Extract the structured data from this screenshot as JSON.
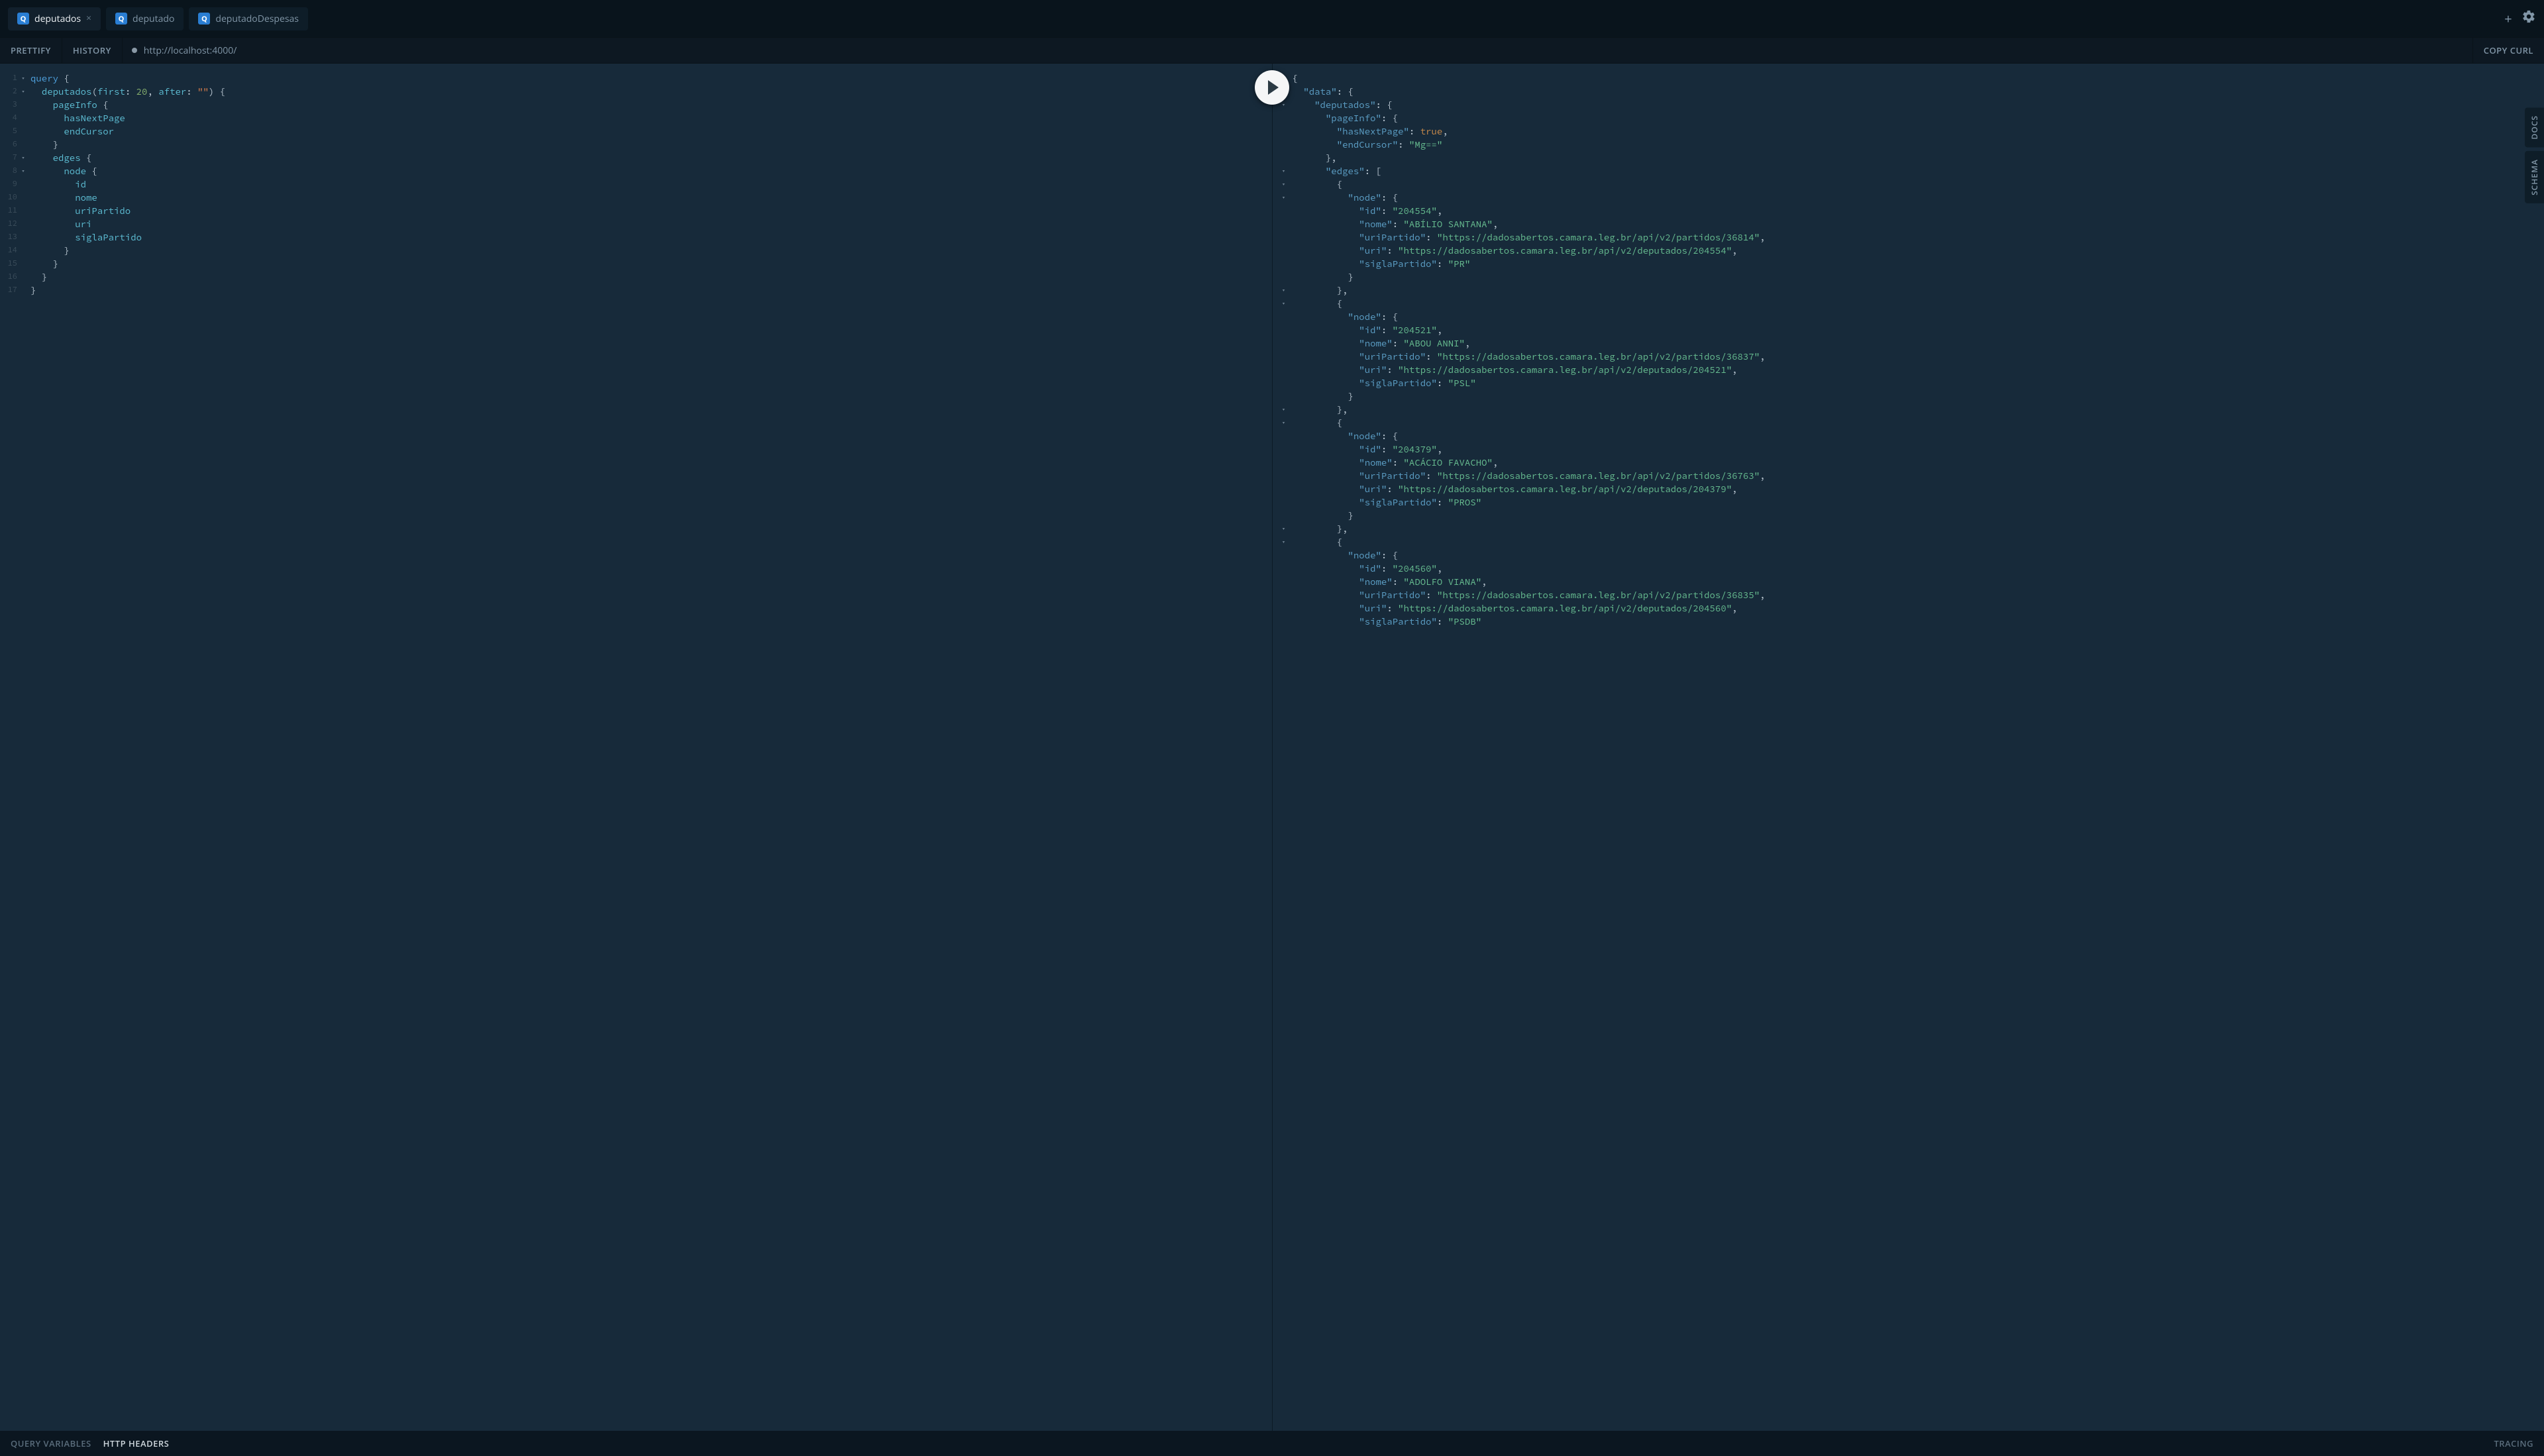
{
  "tabs": [
    {
      "badge": "Q",
      "label": "deputados",
      "active": true,
      "close": "×"
    },
    {
      "badge": "Q",
      "label": "deputado",
      "active": false
    },
    {
      "badge": "Q",
      "label": "deputadoDespesas",
      "active": false
    }
  ],
  "toolbar": {
    "prettify": "PRETTIFY",
    "history": "HISTORY",
    "url": "http://localhost:4000/",
    "copy_curl": "COPY CURL"
  },
  "side": {
    "docs": "DOCS",
    "schema": "SCHEMA"
  },
  "bottom": {
    "query_vars": "QUERY VARIABLES",
    "http_headers": "HTTP HEADERS",
    "tracing": "TRACING"
  },
  "editor": {
    "line_count": 17,
    "fold_lines": [
      1,
      2,
      7,
      8
    ],
    "tokens": [
      [
        [
          "kw",
          "query"
        ],
        [
          "punct",
          " {"
        ]
      ],
      [
        [
          "punct",
          "  "
        ],
        [
          "field",
          "deputados"
        ],
        [
          "punct",
          "("
        ],
        [
          "arg",
          "first"
        ],
        [
          "punct",
          ": "
        ],
        [
          "num",
          "20"
        ],
        [
          "punct",
          ", "
        ],
        [
          "arg",
          "after"
        ],
        [
          "punct",
          ": "
        ],
        [
          "str",
          "\"\""
        ],
        [
          "punct",
          ") {"
        ]
      ],
      [
        [
          "punct",
          "    "
        ],
        [
          "field",
          "pageInfo"
        ],
        [
          "punct",
          " {"
        ]
      ],
      [
        [
          "punct",
          "      "
        ],
        [
          "field",
          "hasNextPage"
        ]
      ],
      [
        [
          "punct",
          "      "
        ],
        [
          "field",
          "endCursor"
        ]
      ],
      [
        [
          "punct",
          "    }"
        ]
      ],
      [
        [
          "punct",
          "    "
        ],
        [
          "field",
          "edges"
        ],
        [
          "punct",
          " {"
        ]
      ],
      [
        [
          "punct",
          "      "
        ],
        [
          "field",
          "node"
        ],
        [
          "punct",
          " {"
        ]
      ],
      [
        [
          "punct",
          "        "
        ],
        [
          "field",
          "id"
        ]
      ],
      [
        [
          "punct",
          "        "
        ],
        [
          "field",
          "nome"
        ]
      ],
      [
        [
          "punct",
          "        "
        ],
        [
          "field",
          "uriPartido"
        ]
      ],
      [
        [
          "punct",
          "        "
        ],
        [
          "field",
          "uri"
        ]
      ],
      [
        [
          "punct",
          "        "
        ],
        [
          "field",
          "siglaPartido"
        ]
      ],
      [
        [
          "punct",
          "      }"
        ]
      ],
      [
        [
          "punct",
          "    }"
        ]
      ],
      [
        [
          "punct",
          "  }"
        ]
      ],
      [
        [
          "punct",
          "}"
        ]
      ]
    ]
  },
  "response": {
    "fold_lines": [
      1,
      2,
      3,
      8,
      9,
      10,
      17,
      18,
      26,
      27,
      35,
      36
    ],
    "tokens": [
      [
        [
          "punct",
          "{"
        ]
      ],
      [
        [
          "punct",
          "  "
        ],
        [
          "propkey",
          "\"data\""
        ],
        [
          "punct",
          ": {"
        ]
      ],
      [
        [
          "punct",
          "    "
        ],
        [
          "propkey",
          "\"deputados\""
        ],
        [
          "punct",
          ": {"
        ]
      ],
      [
        [
          "punct",
          "      "
        ],
        [
          "propkey",
          "\"pageInfo\""
        ],
        [
          "punct",
          ": {"
        ]
      ],
      [
        [
          "punct",
          "        "
        ],
        [
          "propkey",
          "\"hasNextPage\""
        ],
        [
          "punct",
          ": "
        ],
        [
          "valbool",
          "true"
        ],
        [
          "punct",
          ","
        ]
      ],
      [
        [
          "punct",
          "        "
        ],
        [
          "propkey",
          "\"endCursor\""
        ],
        [
          "punct",
          ": "
        ],
        [
          "valstr",
          "\"Mg==\""
        ]
      ],
      [
        [
          "punct",
          "      },"
        ]
      ],
      [
        [
          "punct",
          "      "
        ],
        [
          "propkey",
          "\"edges\""
        ],
        [
          "punct",
          ": ["
        ]
      ],
      [
        [
          "punct",
          "        {"
        ]
      ],
      [
        [
          "punct",
          "          "
        ],
        [
          "propkey",
          "\"node\""
        ],
        [
          "punct",
          ": {"
        ]
      ],
      [
        [
          "punct",
          "            "
        ],
        [
          "propkey",
          "\"id\""
        ],
        [
          "punct",
          ": "
        ],
        [
          "valstr",
          "\"204554\""
        ],
        [
          "punct",
          ","
        ]
      ],
      [
        [
          "punct",
          "            "
        ],
        [
          "propkey",
          "\"nome\""
        ],
        [
          "punct",
          ": "
        ],
        [
          "valstr",
          "\"ABÍLIO SANTANA\""
        ],
        [
          "punct",
          ","
        ]
      ],
      [
        [
          "punct",
          "            "
        ],
        [
          "propkey",
          "\"uriPartido\""
        ],
        [
          "punct",
          ": "
        ],
        [
          "valstr",
          "\"https://dadosabertos.camara.leg.br/api/v2/partidos/36814\""
        ],
        [
          "punct",
          ","
        ]
      ],
      [
        [
          "punct",
          "            "
        ],
        [
          "propkey",
          "\"uri\""
        ],
        [
          "punct",
          ": "
        ],
        [
          "valstr",
          "\"https://dadosabertos.camara.leg.br/api/v2/deputados/204554\""
        ],
        [
          "punct",
          ","
        ]
      ],
      [
        [
          "punct",
          "            "
        ],
        [
          "propkey",
          "\"siglaPartido\""
        ],
        [
          "punct",
          ": "
        ],
        [
          "valstr",
          "\"PR\""
        ]
      ],
      [
        [
          "punct",
          "          }"
        ]
      ],
      [
        [
          "punct",
          "        },"
        ]
      ],
      [
        [
          "punct",
          "        {"
        ]
      ],
      [
        [
          "punct",
          "          "
        ],
        [
          "propkey",
          "\"node\""
        ],
        [
          "punct",
          ": {"
        ]
      ],
      [
        [
          "punct",
          "            "
        ],
        [
          "propkey",
          "\"id\""
        ],
        [
          "punct",
          ": "
        ],
        [
          "valstr",
          "\"204521\""
        ],
        [
          "punct",
          ","
        ]
      ],
      [
        [
          "punct",
          "            "
        ],
        [
          "propkey",
          "\"nome\""
        ],
        [
          "punct",
          ": "
        ],
        [
          "valstr",
          "\"ABOU ANNI\""
        ],
        [
          "punct",
          ","
        ]
      ],
      [
        [
          "punct",
          "            "
        ],
        [
          "propkey",
          "\"uriPartido\""
        ],
        [
          "punct",
          ": "
        ],
        [
          "valstr",
          "\"https://dadosabertos.camara.leg.br/api/v2/partidos/36837\""
        ],
        [
          "punct",
          ","
        ]
      ],
      [
        [
          "punct",
          "            "
        ],
        [
          "propkey",
          "\"uri\""
        ],
        [
          "punct",
          ": "
        ],
        [
          "valstr",
          "\"https://dadosabertos.camara.leg.br/api/v2/deputados/204521\""
        ],
        [
          "punct",
          ","
        ]
      ],
      [
        [
          "punct",
          "            "
        ],
        [
          "propkey",
          "\"siglaPartido\""
        ],
        [
          "punct",
          ": "
        ],
        [
          "valstr",
          "\"PSL\""
        ]
      ],
      [
        [
          "punct",
          "          }"
        ]
      ],
      [
        [
          "punct",
          "        },"
        ]
      ],
      [
        [
          "punct",
          "        {"
        ]
      ],
      [
        [
          "punct",
          "          "
        ],
        [
          "propkey",
          "\"node\""
        ],
        [
          "punct",
          ": {"
        ]
      ],
      [
        [
          "punct",
          "            "
        ],
        [
          "propkey",
          "\"id\""
        ],
        [
          "punct",
          ": "
        ],
        [
          "valstr",
          "\"204379\""
        ],
        [
          "punct",
          ","
        ]
      ],
      [
        [
          "punct",
          "            "
        ],
        [
          "propkey",
          "\"nome\""
        ],
        [
          "punct",
          ": "
        ],
        [
          "valstr",
          "\"ACÁCIO FAVACHO\""
        ],
        [
          "punct",
          ","
        ]
      ],
      [
        [
          "punct",
          "            "
        ],
        [
          "propkey",
          "\"uriPartido\""
        ],
        [
          "punct",
          ": "
        ],
        [
          "valstr",
          "\"https://dadosabertos.camara.leg.br/api/v2/partidos/36763\""
        ],
        [
          "punct",
          ","
        ]
      ],
      [
        [
          "punct",
          "            "
        ],
        [
          "propkey",
          "\"uri\""
        ],
        [
          "punct",
          ": "
        ],
        [
          "valstr",
          "\"https://dadosabertos.camara.leg.br/api/v2/deputados/204379\""
        ],
        [
          "punct",
          ","
        ]
      ],
      [
        [
          "punct",
          "            "
        ],
        [
          "propkey",
          "\"siglaPartido\""
        ],
        [
          "punct",
          ": "
        ],
        [
          "valstr",
          "\"PROS\""
        ]
      ],
      [
        [
          "punct",
          "          }"
        ]
      ],
      [
        [
          "punct",
          "        },"
        ]
      ],
      [
        [
          "punct",
          "        {"
        ]
      ],
      [
        [
          "punct",
          "          "
        ],
        [
          "propkey",
          "\"node\""
        ],
        [
          "punct",
          ": {"
        ]
      ],
      [
        [
          "punct",
          "            "
        ],
        [
          "propkey",
          "\"id\""
        ],
        [
          "punct",
          ": "
        ],
        [
          "valstr",
          "\"204560\""
        ],
        [
          "punct",
          ","
        ]
      ],
      [
        [
          "punct",
          "            "
        ],
        [
          "propkey",
          "\"nome\""
        ],
        [
          "punct",
          ": "
        ],
        [
          "valstr",
          "\"ADOLFO VIANA\""
        ],
        [
          "punct",
          ","
        ]
      ],
      [
        [
          "punct",
          "            "
        ],
        [
          "propkey",
          "\"uriPartido\""
        ],
        [
          "punct",
          ": "
        ],
        [
          "valstr",
          "\"https://dadosabertos.camara.leg.br/api/v2/partidos/36835\""
        ],
        [
          "punct",
          ","
        ]
      ],
      [
        [
          "punct",
          "            "
        ],
        [
          "propkey",
          "\"uri\""
        ],
        [
          "punct",
          ": "
        ],
        [
          "valstr",
          "\"https://dadosabertos.camara.leg.br/api/v2/deputados/204560\""
        ],
        [
          "punct",
          ","
        ]
      ],
      [
        [
          "punct",
          "            "
        ],
        [
          "propkey",
          "\"siglaPartido\""
        ],
        [
          "punct",
          ": "
        ],
        [
          "valstr",
          "\"PSDB\""
        ]
      ]
    ]
  }
}
